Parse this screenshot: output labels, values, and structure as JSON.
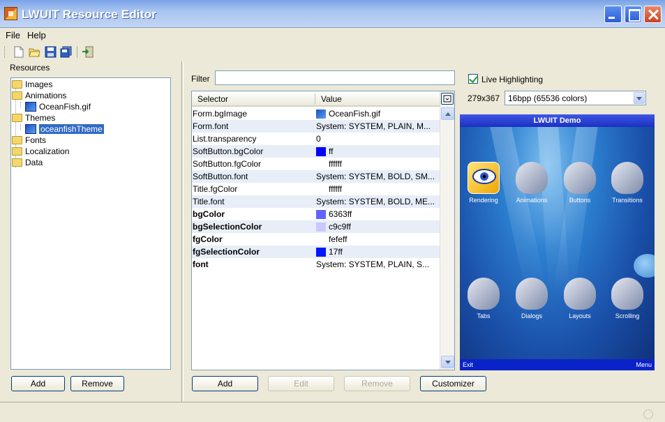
{
  "window": {
    "title": "LWUIT Resource Editor"
  },
  "menu": {
    "file": "File",
    "help": "Help"
  },
  "toolbar": {
    "icons": [
      "new-file-icon",
      "open-folder-icon",
      "save-icon",
      "save-all-icon",
      "import-icon"
    ]
  },
  "resources": {
    "label": "Resources",
    "tree": {
      "images": "Images",
      "animations": "Animations",
      "animation_child": "OceanFish.gif",
      "themes": "Themes",
      "theme_child": "oceanfishTheme",
      "fonts": "Fonts",
      "localization": "Localization",
      "data": "Data"
    },
    "add_label": "Add",
    "remove_label": "Remove"
  },
  "theme_editor": {
    "filter_label": "Filter",
    "filter_value": "",
    "columns": {
      "selector": "Selector",
      "value": "Value"
    },
    "rows": [
      {
        "selector": "Form.bgImage",
        "value": "OceanFish.gif",
        "bold": false,
        "swatch": "image"
      },
      {
        "selector": "Form.font",
        "value": "System: SYSTEM, PLAIN, M...",
        "bold": false,
        "swatch": ""
      },
      {
        "selector": "List.transparency",
        "value": "0",
        "bold": false,
        "swatch": ""
      },
      {
        "selector": "SoftButton.bgColor",
        "value": "ff",
        "bold": false,
        "swatch": "#0000ff"
      },
      {
        "selector": "SoftButton.fgColor",
        "value": "ffffff",
        "bold": false,
        "swatch": "#ffffff"
      },
      {
        "selector": "SoftButton.font",
        "value": "System: SYSTEM, BOLD, SM...",
        "bold": false,
        "swatch": ""
      },
      {
        "selector": "Title.fgColor",
        "value": "ffffff",
        "bold": false,
        "swatch": "#ffffff"
      },
      {
        "selector": "Title.font",
        "value": "System: SYSTEM, BOLD, ME...",
        "bold": false,
        "swatch": ""
      },
      {
        "selector": "bgColor",
        "value": "6363ff",
        "bold": true,
        "swatch": "#6363ff"
      },
      {
        "selector": "bgSelectionColor",
        "value": "c9c9ff",
        "bold": true,
        "swatch": "#c9c9ff"
      },
      {
        "selector": "fgColor",
        "value": "fefeff",
        "bold": true,
        "swatch": "#fefeff"
      },
      {
        "selector": "fgSelectionColor",
        "value": "17ff",
        "bold": true,
        "swatch": "#0017ff"
      },
      {
        "selector": "font",
        "value": "System: SYSTEM, PLAIN, S...",
        "bold": true,
        "swatch": ""
      }
    ],
    "add_label": "Add",
    "edit_label": "Edit",
    "remove_label": "Remove",
    "customizer_label": "Customizer"
  },
  "preview": {
    "live_highlighting_label": "Live Highlighting",
    "live_highlighting_checked": true,
    "resolution": "279x367",
    "color_depth": "16bpp (65536 colors)",
    "device": {
      "title": "LWUIT Demo",
      "items": [
        "Rendering",
        "Animations",
        "Buttons",
        "Transitions",
        "Tabs",
        "Dialogs",
        "Layouts",
        "Scrolling"
      ],
      "selected_item": "Rendering",
      "left_soft": "Exit",
      "right_soft": "Menu"
    }
  },
  "colors": {
    "selection": "#316ac5",
    "title_bar": "#1a30c0",
    "alt_row": "#e8eef8"
  }
}
